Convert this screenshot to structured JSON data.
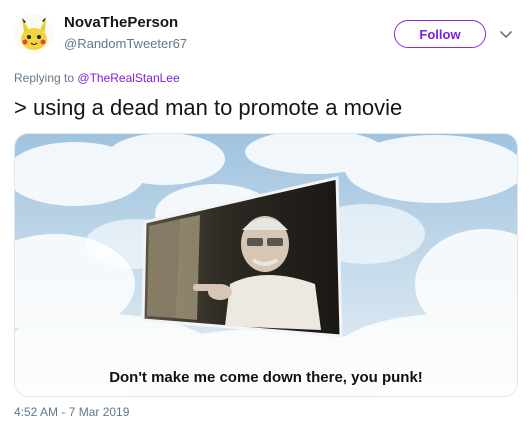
{
  "user": {
    "display_name": "NovaThePerson",
    "handle": "@RandomTweeter67"
  },
  "actions": {
    "follow_label": "Follow"
  },
  "reply": {
    "prefix": "Replying to",
    "mention": "@TheRealStanLee"
  },
  "tweet": {
    "text": "> using a dead man to promote a movie",
    "media_caption": "Don't make me come down there, you punk!",
    "timestamp": "4:52 AM - 7 Mar 2019"
  },
  "colors": {
    "accent": "#7b1fe0",
    "secondary_text": "#657786",
    "primary_text": "#14171a"
  },
  "icons": {
    "avatar": "pikachu-avatar",
    "more": "chevron-down-icon"
  }
}
